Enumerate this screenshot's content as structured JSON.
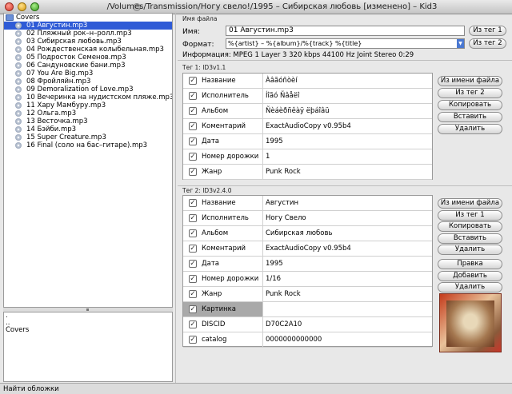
{
  "window": {
    "title": "/Volumes/Transmission/Ногу свело!/1995 – Сибирская любовь [изменено] – Kid3"
  },
  "files": {
    "root": "Covers",
    "items": [
      "01 Августин.mp3",
      "02 Пляжный рок–н–ролл.mp3",
      "03 Сибирская любовь.mp3",
      "04 Рождественская колыбельная.mp3",
      "05 Подросток Семенов.mp3",
      "06 Сандуновские бани.mp3",
      "07 You Are Big.mp3",
      "08 Фройляйн.mp3",
      "09 Demoralization of Love.mp3",
      "10 Вечеринка на нудистском пляже.mp3",
      "11 Хару Мамбуру.mp3",
      "12 Ольга.mp3",
      "13 Весточка.mp3",
      "14 Бэйби.mp3",
      "15 Super Creature.mp3",
      "16 Final (соло на бас–гитаре).mp3"
    ],
    "selected_index": 0
  },
  "dirs": {
    "items": [
      ".",
      "..",
      "Covers"
    ]
  },
  "status": "Найти обложки",
  "file_section": {
    "caption": "Имя файла",
    "name_label": "Имя:",
    "name_value": "01 Августин.mp3",
    "format_label": "Формат:",
    "format_value": "%{artist} – %{album}/%{track} %{title}",
    "info_label": "Информация:",
    "info_value": "MPEG 1 Layer 3 320 kbps 44100 Hz Joint Stereo 0:29",
    "btn_tag1": "Из тег 1",
    "btn_tag2": "Из тег 2"
  },
  "tag1": {
    "caption": "Тег 1: ID3v1.1",
    "rows": [
      {
        "name": "Название",
        "value": "Àâãóñòèí"
      },
      {
        "name": "Исполнитель",
        "value": "Íîãó Ñâåëî"
      },
      {
        "name": "Альбом",
        "value": "Ñèáèðñêàÿ ëþáîâü"
      },
      {
        "name": "Коментарий",
        "value": "ExactAudioCopy v0.95b4"
      },
      {
        "name": "Дата",
        "value": "1995"
      },
      {
        "name": "Номер дорожки",
        "value": "1"
      },
      {
        "name": "Жанр",
        "value": "Punk Rock"
      }
    ],
    "buttons": [
      "Из имени файла",
      "Из тег 2",
      "Копировать",
      "Вставить",
      "Удалить"
    ]
  },
  "tag2": {
    "caption": "Тег 2: ID3v2.4.0",
    "rows": [
      {
        "name": "Название",
        "value": "Августин"
      },
      {
        "name": "Исполнитель",
        "value": "Ногу Свело"
      },
      {
        "name": "Альбом",
        "value": "Сибирская любовь"
      },
      {
        "name": "Коментарий",
        "value": "ExactAudioCopy v0.95b4"
      },
      {
        "name": "Дата",
        "value": "1995"
      },
      {
        "name": "Номер дорожки",
        "value": "1/16"
      },
      {
        "name": "Жанр",
        "value": "Punk Rock"
      },
      {
        "name": "Картинка",
        "value": ""
      },
      {
        "name": "DISCID",
        "value": "D70C2A10"
      },
      {
        "name": "catalog",
        "value": "0000000000000"
      }
    ],
    "buttons": [
      "Из имени файла",
      "Из тег 1",
      "Копировать",
      "Вставить",
      "Удалить"
    ],
    "frame_buttons": [
      "Правка",
      "Добавить",
      "Удалить"
    ]
  },
  "colors": {
    "selection": "#2f5bd6",
    "highlight_row": "#a9a9a9"
  }
}
